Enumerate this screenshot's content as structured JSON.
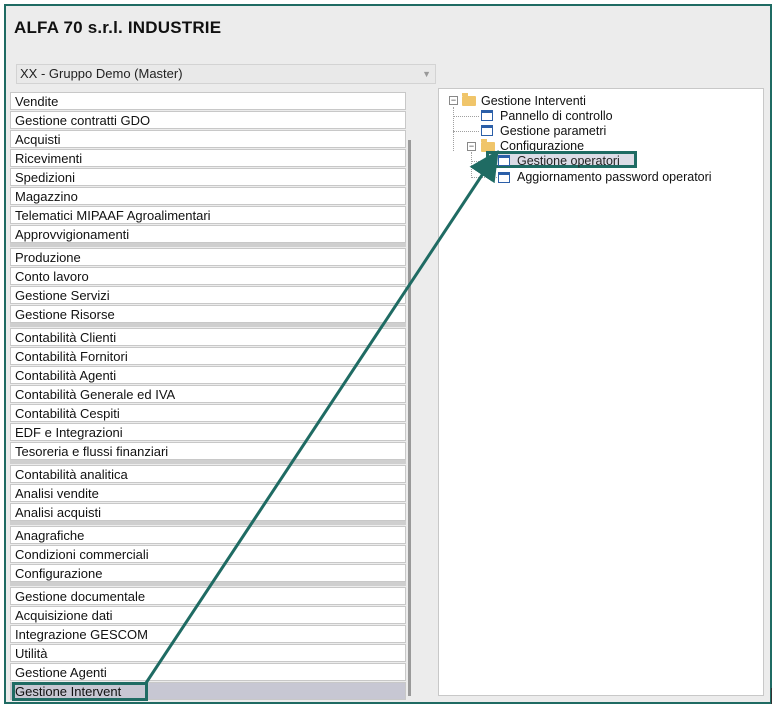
{
  "app": {
    "title": "ALFA 70 s.r.l. INDUSTRIE"
  },
  "company_select": {
    "value": "XX - Gruppo Demo (Master)"
  },
  "menu": {
    "items": [
      {
        "label": "Vendite"
      },
      {
        "label": "Gestione contratti GDO"
      },
      {
        "label": "Acquisti"
      },
      {
        "label": "Ricevimenti"
      },
      {
        "label": "Spedizioni"
      },
      {
        "label": "Magazzino"
      },
      {
        "label": "Telematici MIPAAF Agroalimentari"
      },
      {
        "label": "Approvvigionamenti"
      },
      {
        "label": "Produzione"
      },
      {
        "label": "Conto lavoro"
      },
      {
        "label": "Gestione Servizi"
      },
      {
        "label": "Gestione Risorse"
      },
      {
        "label": "Contabilità Clienti"
      },
      {
        "label": "Contabilità Fornitori"
      },
      {
        "label": "Contabilità Agenti"
      },
      {
        "label": "Contabilità Generale ed IVA"
      },
      {
        "label": "Contabilità Cespiti"
      },
      {
        "label": "EDF e Integrazioni"
      },
      {
        "label": "Tesoreria e flussi finanziari"
      },
      {
        "label": "Contabilità analitica"
      },
      {
        "label": "Analisi vendite"
      },
      {
        "label": "Analisi acquisti"
      },
      {
        "label": "Anagrafiche"
      },
      {
        "label": "Condizioni commerciali"
      },
      {
        "label": "Configurazione"
      },
      {
        "label": "Gestione documentale"
      },
      {
        "label": "Acquisizione dati"
      },
      {
        "label": "Integrazione GESCOM"
      },
      {
        "label": "Utilità"
      },
      {
        "label": "Gestione Agenti"
      },
      {
        "label": "Gestione Intervent"
      }
    ],
    "selected": "Gestione Intervent"
  },
  "tree": {
    "root": "Gestione Interventi",
    "children": [
      {
        "label": "Pannello di controllo"
      },
      {
        "label": "Gestione parametri"
      },
      {
        "label": "Configurazione"
      },
      {
        "label": "Gestione operatori"
      },
      {
        "label": "Aggiornamento password operatori"
      }
    ]
  },
  "colors": {
    "accent": "#1f6b63",
    "selection": "#c7c7d3"
  }
}
